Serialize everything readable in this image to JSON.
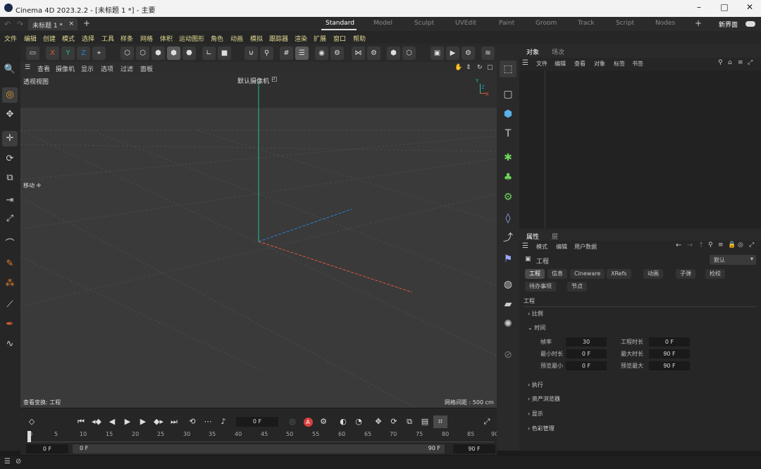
{
  "window": {
    "title": "Cinema 4D 2023.2.2 - [未标题 1 *] - 主要"
  },
  "tabs": {
    "file_tab": "未标题 1 *",
    "layouts": [
      "Standard",
      "Model",
      "Sculpt",
      "UVEdit",
      "Paint",
      "Groom",
      "Track",
      "Script",
      "Nodes"
    ],
    "new_layout": "新界面"
  },
  "menu": [
    "文件",
    "编辑",
    "创建",
    "模式",
    "选择",
    "工具",
    "样条",
    "网格",
    "体积",
    "运动图形",
    "角色",
    "动画",
    "模拟",
    "跟踪器",
    "渲染",
    "扩展",
    "窗口",
    "帮助"
  ],
  "axes": {
    "x": "X",
    "y": "Y",
    "z": "Z"
  },
  "viewport": {
    "menu": [
      "查看",
      "摄像机",
      "显示",
      "选项",
      "过滤",
      "面板"
    ],
    "name": "透视视图",
    "camera": "默认摄像机",
    "hud_move": "移动",
    "selection_info": "查看变换: 工程",
    "grid_spacing": "网格间距 : 500 cm"
  },
  "timeline": {
    "current_frame": "0 F",
    "ruler": [
      "0",
      "5",
      "10",
      "15",
      "20",
      "25",
      "30",
      "35",
      "40",
      "45",
      "50",
      "55",
      "60",
      "65",
      "70",
      "75",
      "80",
      "85",
      "90"
    ],
    "range_start_field": "0 F",
    "range_begin": "0 F",
    "range_end": "90 F",
    "range_end_field": "90 F"
  },
  "objects_panel": {
    "tabs": [
      "对象",
      "场次"
    ],
    "menu": [
      "文件",
      "编辑",
      "查看",
      "对象",
      "标签",
      "书签"
    ]
  },
  "attributes_panel": {
    "tabs": [
      "属性",
      "层"
    ],
    "menu": [
      "模式",
      "编辑",
      "用户数据"
    ],
    "title": "工程",
    "preset": "默认",
    "chips": [
      "工程",
      "信息",
      "Cineware",
      "XRefs",
      "动画",
      "子弹",
      "检校",
      "待办事项",
      "节点"
    ],
    "section_title": "工程",
    "groups": [
      "比例",
      "时间",
      "执行",
      "资产浏览器",
      "显示",
      "色彩管理"
    ],
    "time_fields": {
      "fps_label": "帧率",
      "fps": "30",
      "project_time_label": "工程时长",
      "project_time": "0 F",
      "min_time_label": "最小时长",
      "min_time": "0 F",
      "max_time_label": "最大时长",
      "max_time": "90 F",
      "preview_min_label": "预览最小",
      "preview_min": "0 F",
      "preview_max_label": "预览最大",
      "preview_max": "90 F"
    }
  },
  "colors": {
    "accent": "#e0d890",
    "x_axis": "#e05a3a",
    "y_axis": "#1fc08a",
    "z_axis": "#2a7fd8"
  }
}
